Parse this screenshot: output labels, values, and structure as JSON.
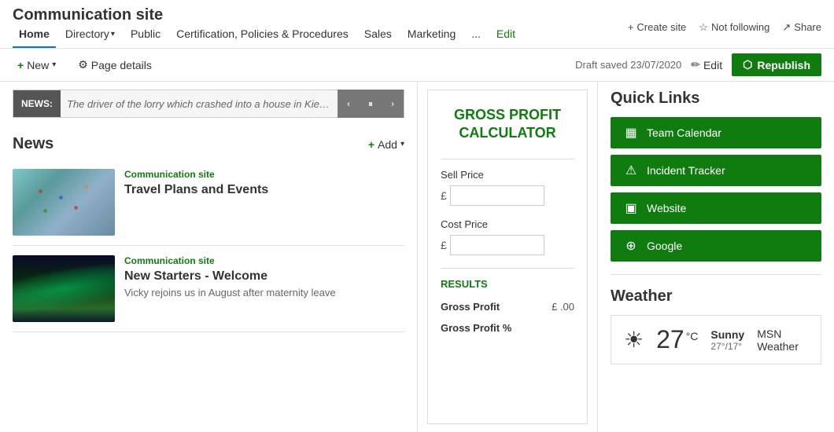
{
  "site": {
    "title": "Communication site"
  },
  "nav": {
    "links": [
      {
        "label": "Home",
        "active": true
      },
      {
        "label": "Directory",
        "hasArrow": true
      },
      {
        "label": "Public",
        "hasArrow": false
      },
      {
        "label": "Certification, Policies & Procedures",
        "hasArrow": false
      },
      {
        "label": "Sales",
        "hasArrow": false
      },
      {
        "label": "Marketing",
        "hasArrow": false
      },
      {
        "label": "...",
        "hasArrow": false
      },
      {
        "label": "Edit",
        "isEdit": true
      }
    ],
    "topRight": {
      "create": "Create site",
      "follow": "Not following",
      "share": "Share"
    }
  },
  "toolbar": {
    "new_label": "New",
    "page_details_label": "Page details",
    "draft_saved": "Draft saved 23/07/2020",
    "edit_label": "Edit",
    "republish_label": "Republish"
  },
  "newsTicker": {
    "label": "NEWS:",
    "text": "The driver of the lorry which crashed into a house in Kiebroek..."
  },
  "newsSection": {
    "title": "News",
    "addLabel": "Add",
    "items": [
      {
        "source": "Communication site",
        "title": "Travel Plans and Events",
        "excerpt": "",
        "type": "map"
      },
      {
        "source": "Communication site",
        "title": "New Starters - Welcome",
        "excerpt": "Vicky           rejoins us in August after maternity leave",
        "type": "aurora"
      }
    ]
  },
  "calculator": {
    "title": "GROSS PROFIT CALCULATOR",
    "sellPriceLabel": "Sell Price",
    "costPriceLabel": "Cost Price",
    "currencySymbol": "£",
    "resultsLabel": "RESULTS",
    "grossProfitLabel": "Gross Profit",
    "grossProfitValue": "£ .00",
    "grossProfitPctLabel": "Gross Profit %",
    "grossProfitPctValue": ""
  },
  "quickLinks": {
    "title": "Quick Links",
    "items": [
      {
        "label": "Team Calendar",
        "icon": "calendar"
      },
      {
        "label": "Incident Tracker",
        "icon": "alert"
      },
      {
        "label": "Website",
        "icon": "screen"
      },
      {
        "label": "Google",
        "icon": "globe"
      }
    ]
  },
  "weather": {
    "title": "Weather",
    "temp": "27",
    "unit": "°C",
    "description": "Sunny",
    "range": "27°/17°",
    "source": "MSN Weather"
  }
}
